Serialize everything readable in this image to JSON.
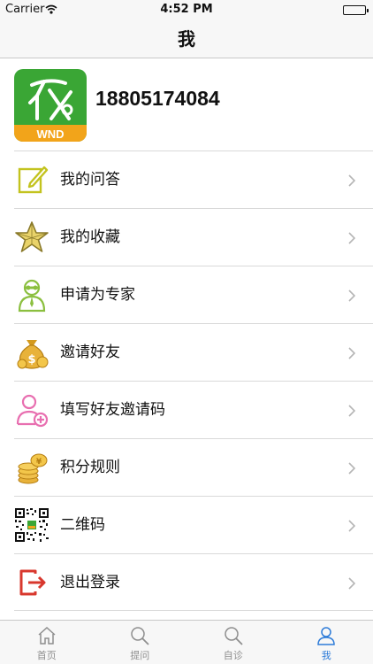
{
  "status_bar": {
    "carrier": "Carrier",
    "time": "4:52 PM"
  },
  "nav": {
    "title": "我"
  },
  "profile": {
    "phone": "18805174084",
    "logo_text": "WND"
  },
  "menu": [
    {
      "label": "我的问答",
      "icon": "edit-note-icon"
    },
    {
      "label": "我的收藏",
      "icon": "star-icon"
    },
    {
      "label": "申请为专家",
      "icon": "expert-person-icon"
    },
    {
      "label": "邀请好友",
      "icon": "money-bag-icon"
    },
    {
      "label": "填写好友邀请码",
      "icon": "add-user-icon"
    },
    {
      "label": "积分规则",
      "icon": "coin-stack-icon"
    },
    {
      "label": "二维码",
      "icon": "qr-code-icon"
    },
    {
      "label": "退出登录",
      "icon": "logout-icon"
    }
  ],
  "tabs": [
    {
      "label": "首页",
      "icon": "home-icon"
    },
    {
      "label": "提问",
      "icon": "search-icon"
    },
    {
      "label": "自诊",
      "icon": "search-icon"
    },
    {
      "label": "我",
      "icon": "person-icon",
      "active": true
    }
  ],
  "colors": {
    "accent": "#2d7bd8",
    "logo_green": "#3aa635",
    "logo_orange": "#f2a41a"
  }
}
